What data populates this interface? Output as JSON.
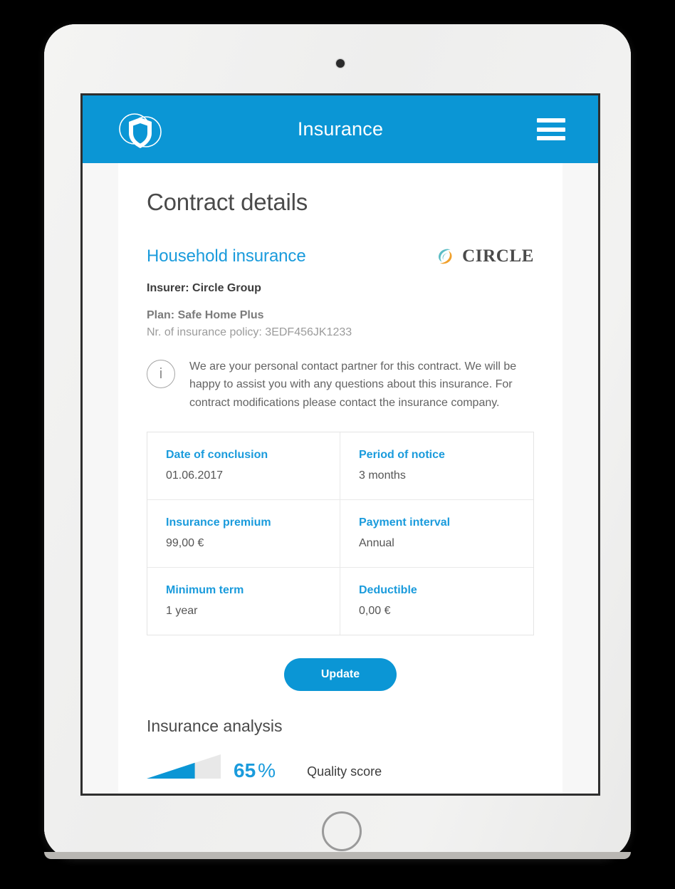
{
  "device": {
    "camera_icon": "camera-dot",
    "home_button_icon": "home-button"
  },
  "header": {
    "title": "Insurance",
    "brand_logo_icon": "shield-circles-logo",
    "menu_icon": "hamburger-menu-icon",
    "background_color": "#0b96d5"
  },
  "page": {
    "title": "Contract details"
  },
  "product": {
    "name": "Household insurance",
    "insurer_logo_icon": "circle-swirl-logo",
    "insurer_logo_word": "CIRCLE",
    "insurer_line": "Insurer: Circle Group",
    "plan_line": "Plan: Safe Home Plus",
    "policy_line": "Nr. of insurance policy: 3EDF456JK1233",
    "accent_color": "#1a9bdc"
  },
  "info": {
    "icon": "info-circle-icon",
    "text": "We are your personal contact partner for this contract. We will be happy to assist you with any questions about this insurance. For contract modifications please contact the insurance company."
  },
  "details": {
    "cells": [
      {
        "label": "Date of conclusion",
        "value": "01.06.2017"
      },
      {
        "label": "Period of notice",
        "value": "3 months"
      },
      {
        "label": "Insurance premium",
        "value": "99,00 €"
      },
      {
        "label": "Payment interval",
        "value": "Annual"
      },
      {
        "label": "Minimum term",
        "value": "1 year"
      },
      {
        "label": "Deductible",
        "value": "0,00 €"
      }
    ]
  },
  "actions": {
    "update_label": "Update"
  },
  "analysis": {
    "section_title": "Insurance analysis",
    "gauge_icon": "quality-score-gauge",
    "score_number": "65",
    "score_unit": "%",
    "score_label": "Quality score",
    "score_percent": 65,
    "gauge_fill_color": "#0b96d5",
    "gauge_track_color": "#e8e8e8"
  }
}
